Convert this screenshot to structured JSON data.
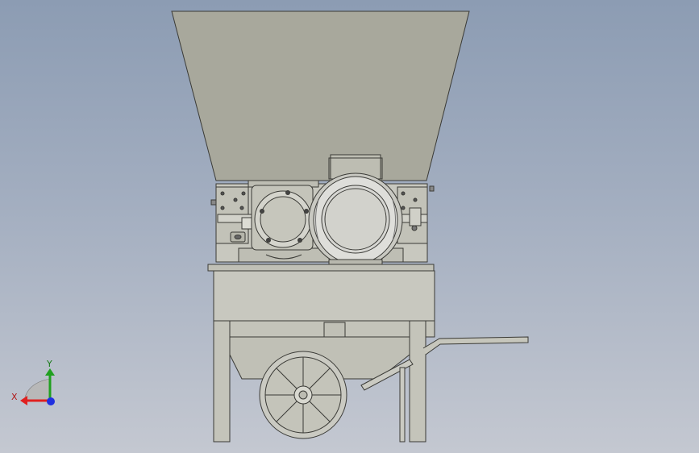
{
  "triad": {
    "x_label": "X",
    "y_label": "Y",
    "x_color": "#e02020",
    "y_color": "#20a020",
    "z_color": "#2030e0"
  },
  "colors": {
    "body": "#c8c8bf",
    "hopper": "#a8a89c",
    "stroke": "#3a3a36",
    "motor": "#d6d6d2"
  }
}
